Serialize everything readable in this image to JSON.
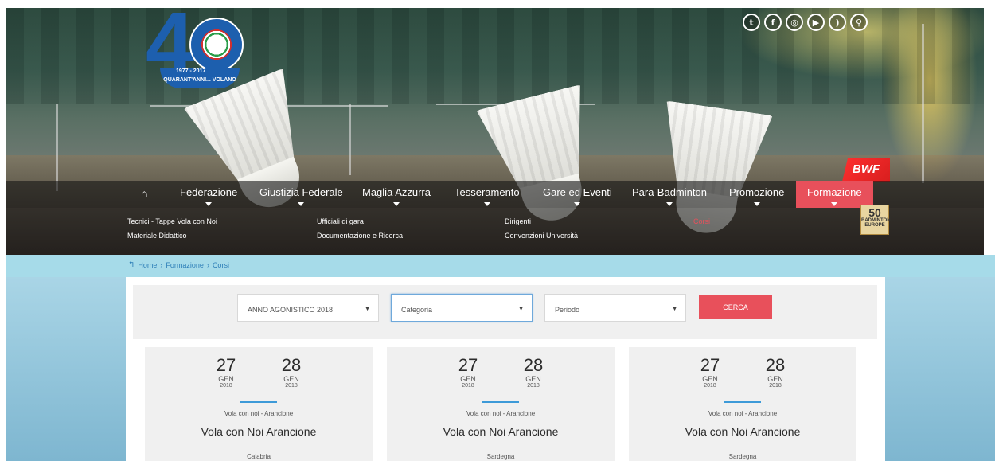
{
  "social": [
    "twitter-icon",
    "facebook-icon",
    "instagram-icon",
    "youtube-icon",
    "rss-icon",
    "search-icon"
  ],
  "logo": {
    "years": "1977 - 2017",
    "motto": "QUARANT'ANNI... VOLANO"
  },
  "partners": {
    "bwf": "BWF",
    "badminton_europe": "50",
    "badminton_europe_text": "BADMINTON EUROPE"
  },
  "nav": {
    "items": [
      "Federazione",
      "Giustizia Federale",
      "Maglia Azzurra",
      "Tesseramento",
      "Gare ed Eventi",
      "Para-Badminton",
      "Promozione",
      "Formazione"
    ],
    "active": "Formazione"
  },
  "submenu": [
    "Tecnici - Tappe Vola con Noi",
    "Ufficiali di gara",
    "Dirigenti",
    "Corsi",
    "Materiale Didattico",
    "Documentazione e Ricerca",
    "Convenzioni Università"
  ],
  "breadcrumb": [
    "Home",
    "Formazione",
    "Corsi"
  ],
  "filters": {
    "anno": "ANNO AGONISTICO 2018",
    "categoria": "Categoria",
    "periodo": "Periodo",
    "button": "CERCA"
  },
  "cards": [
    {
      "start": {
        "day": "27",
        "month": "GEN",
        "year": "2018"
      },
      "end": {
        "day": "28",
        "month": "GEN",
        "year": "2018"
      },
      "category": "Vola con noi - Arancione",
      "title": "Vola con Noi Arancione",
      "region": "Calabria"
    },
    {
      "start": {
        "day": "27",
        "month": "GEN",
        "year": "2018"
      },
      "end": {
        "day": "28",
        "month": "GEN",
        "year": "2018"
      },
      "category": "Vola con noi - Arancione",
      "title": "Vola con Noi Arancione",
      "region": "Sardegna"
    },
    {
      "start": {
        "day": "27",
        "month": "GEN",
        "year": "2018"
      },
      "end": {
        "day": "28",
        "month": "GEN",
        "year": "2018"
      },
      "category": "Vola con noi - Arancione",
      "title": "Vola con Noi Arancione",
      "region": "Sardegna"
    }
  ],
  "colors": {
    "accent": "#e8505b",
    "link": "#2e7fb8",
    "breadcrumb_bar": "#a6dbe9",
    "divider": "#3d9ad8"
  }
}
